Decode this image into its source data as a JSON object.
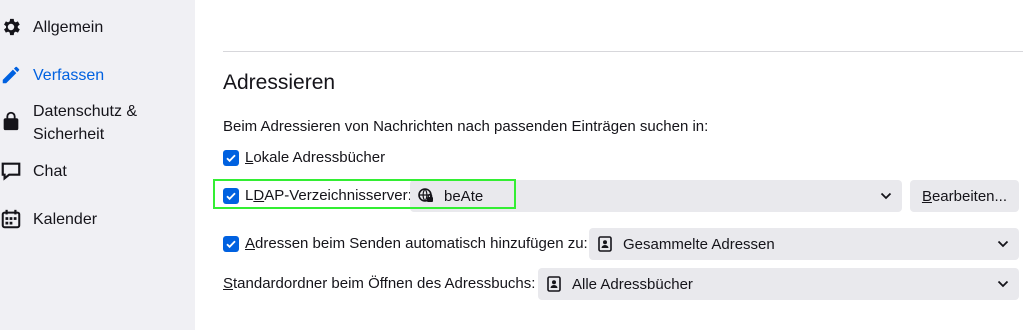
{
  "sidebar": {
    "items": [
      {
        "label": "Allgemein",
        "icon": "gear-icon"
      },
      {
        "label": "Verfassen",
        "icon": "pencil-icon",
        "selected": true
      },
      {
        "label_line1": "Datenschutz &",
        "label_line2": "Sicherheit",
        "icon": "lock-icon"
      },
      {
        "label": "Chat",
        "icon": "chat-bubble-icon"
      },
      {
        "label": "Kalender",
        "icon": "calendar-icon"
      }
    ]
  },
  "addressing": {
    "title": "Adressieren",
    "description": "Beim Adressieren von Nachrichten nach passenden Einträgen suchen in:",
    "local_books": {
      "first": "L",
      "rest": "okale Adressbücher",
      "checked": true
    },
    "ldap": {
      "pre": "L",
      "ul": "D",
      "post": "AP-Verzeichnisserver:",
      "checked": true,
      "selected_server": "beAte",
      "edit_button": {
        "ul": "B",
        "rest": "earbeiten..."
      }
    },
    "auto_add": {
      "first": "A",
      "rest": "dressen beim Senden automatisch hinzufügen zu:",
      "checked": true,
      "selected_book": "Gesammelte Adressen"
    },
    "default_folder": {
      "first": "S",
      "rest": "tandardordner beim Öffnen des Adressbuchs:",
      "selected_book": "Alle Adressbücher"
    }
  },
  "colors": {
    "accent": "#0061e0",
    "sidebar_bg": "#f0f0f4",
    "highlight": "#33ee33"
  }
}
